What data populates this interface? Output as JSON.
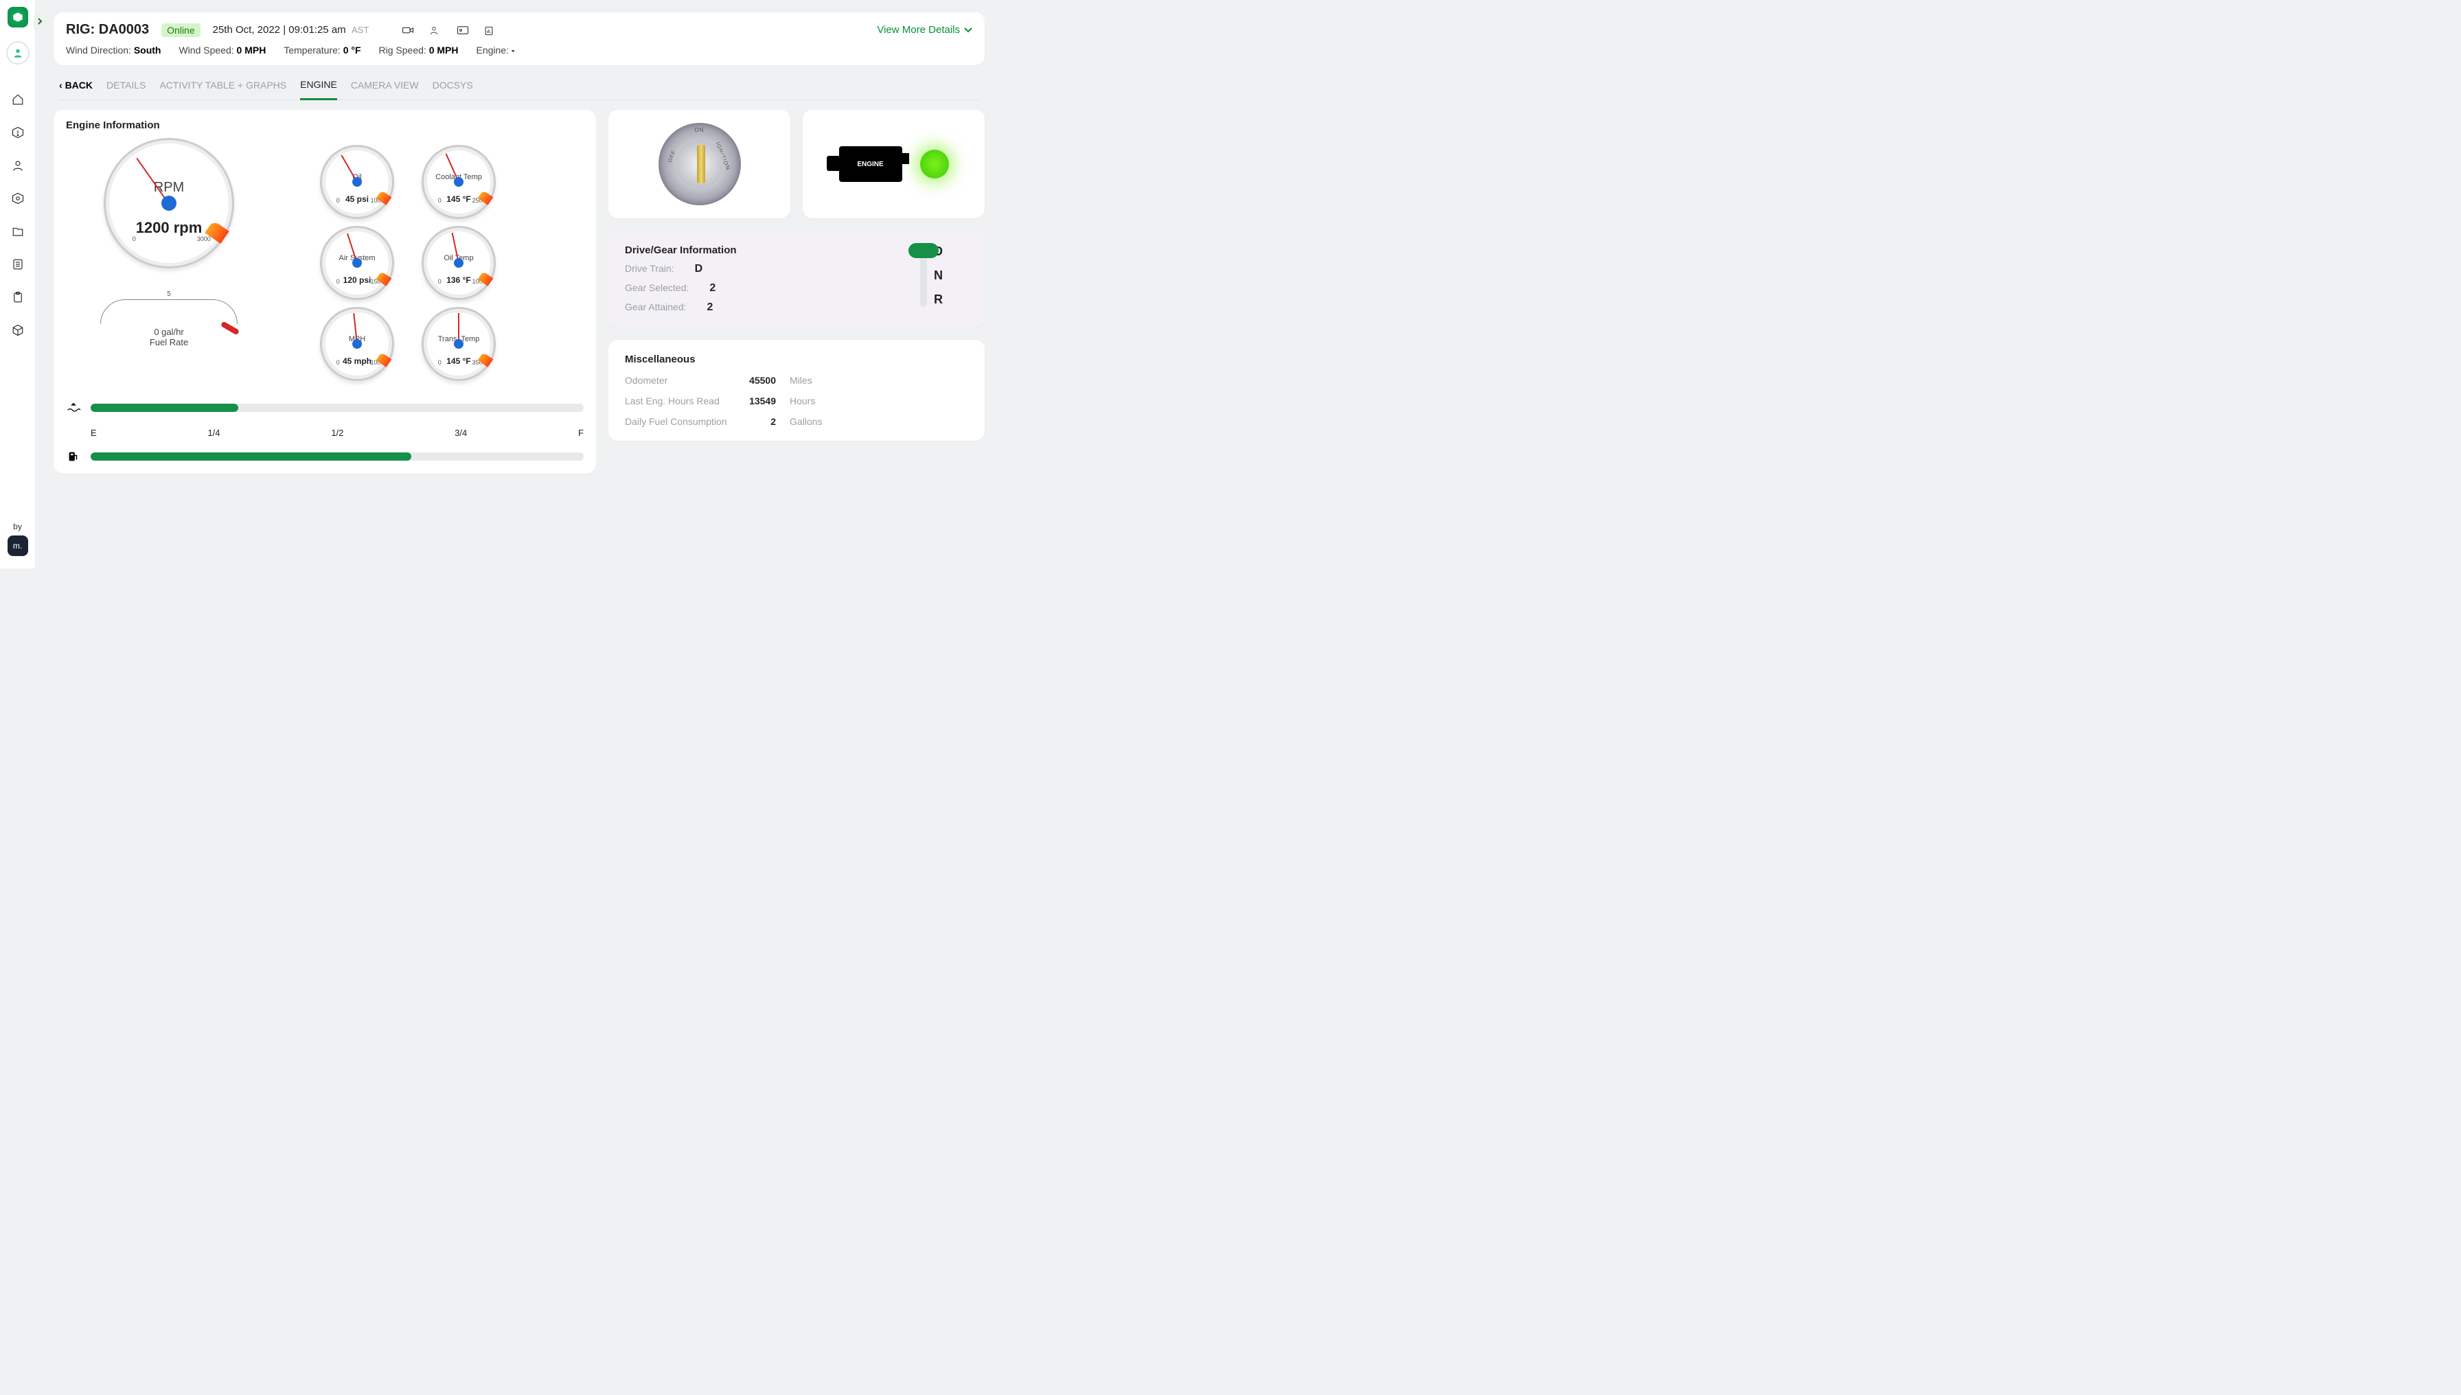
{
  "sidebar": {
    "by_label": "by",
    "m_label": "m."
  },
  "header": {
    "rig_title": "RIG: DA0003",
    "status": "Online",
    "timestamp": "25th Oct, 2022 | 09:01:25 am",
    "timezone": "AST",
    "view_more": "View More Details",
    "stats": {
      "wind_dir_label": "Wind Direction:",
      "wind_dir": "South",
      "wind_speed_label": "Wind Speed:",
      "wind_speed": "0 MPH",
      "temp_label": "Temperature:",
      "temp": "0 °F",
      "rig_speed_label": "Rig Speed:",
      "rig_speed": "0 MPH",
      "engine_label": "Engine:",
      "engine": "-"
    }
  },
  "tabs": {
    "back": "BACK",
    "items": [
      "DETAILS",
      "ACTIVITY TABLE + GRAPHS",
      "ENGINE",
      "CAMERA VIEW",
      "DOCSYS"
    ],
    "active": "ENGINE"
  },
  "engine": {
    "section_title": "Engine Information",
    "rpm_label": "RPM",
    "rpm_value": "1200 rpm",
    "rpm_min": "0",
    "rpm_max": "3000",
    "fuel_rate_scale": "5",
    "fuel_rate_value": "0 gal/hr",
    "fuel_rate_label": "Fuel Rate",
    "gauges": [
      {
        "label": "Oil",
        "value": "45 psi",
        "min": "0",
        "max": "100"
      },
      {
        "label": "Coolant Temp",
        "value": "145 °F",
        "min": "0",
        "max": "250"
      },
      {
        "label": "Air System",
        "value": "120 psi",
        "min": "0",
        "max": "150"
      },
      {
        "label": "Oil Temp",
        "value": "136 °F",
        "min": "0",
        "max": "100"
      },
      {
        "label": "MPH",
        "value": "45 mph",
        "min": "0",
        "max": "100"
      },
      {
        "label": "Trans. Temp",
        "value": "145 °F",
        "min": "0",
        "max": "350"
      }
    ],
    "slider_marks": [
      "E",
      "1/4",
      "1/2",
      "3/4",
      "F"
    ],
    "water_fill_pct": 30,
    "fuel_fill_pct": 65,
    "ignition": {
      "off": "OFF",
      "on": "ON",
      "ignition": "IGNITION"
    },
    "engine_block_label": "ENGINE"
  },
  "gear": {
    "section_title": "Drive/Gear Information",
    "drive_train_label": "Drive Train:",
    "drive_train": "D",
    "gear_selected_label": "Gear Selected:",
    "gear_selected": "2",
    "gear_attained_label": "Gear Attained:",
    "gear_attained": "2",
    "positions": [
      "D",
      "N",
      "R"
    ]
  },
  "misc": {
    "section_title": "Miscellaneous",
    "rows": [
      {
        "label": "Odometer",
        "value": "45500",
        "unit": "Miles"
      },
      {
        "label": "Last Eng. Hours Read",
        "value": "13549",
        "unit": "Hours"
      },
      {
        "label": "Daily Fuel Consumption",
        "value": "2",
        "unit": "Gallons"
      }
    ]
  }
}
